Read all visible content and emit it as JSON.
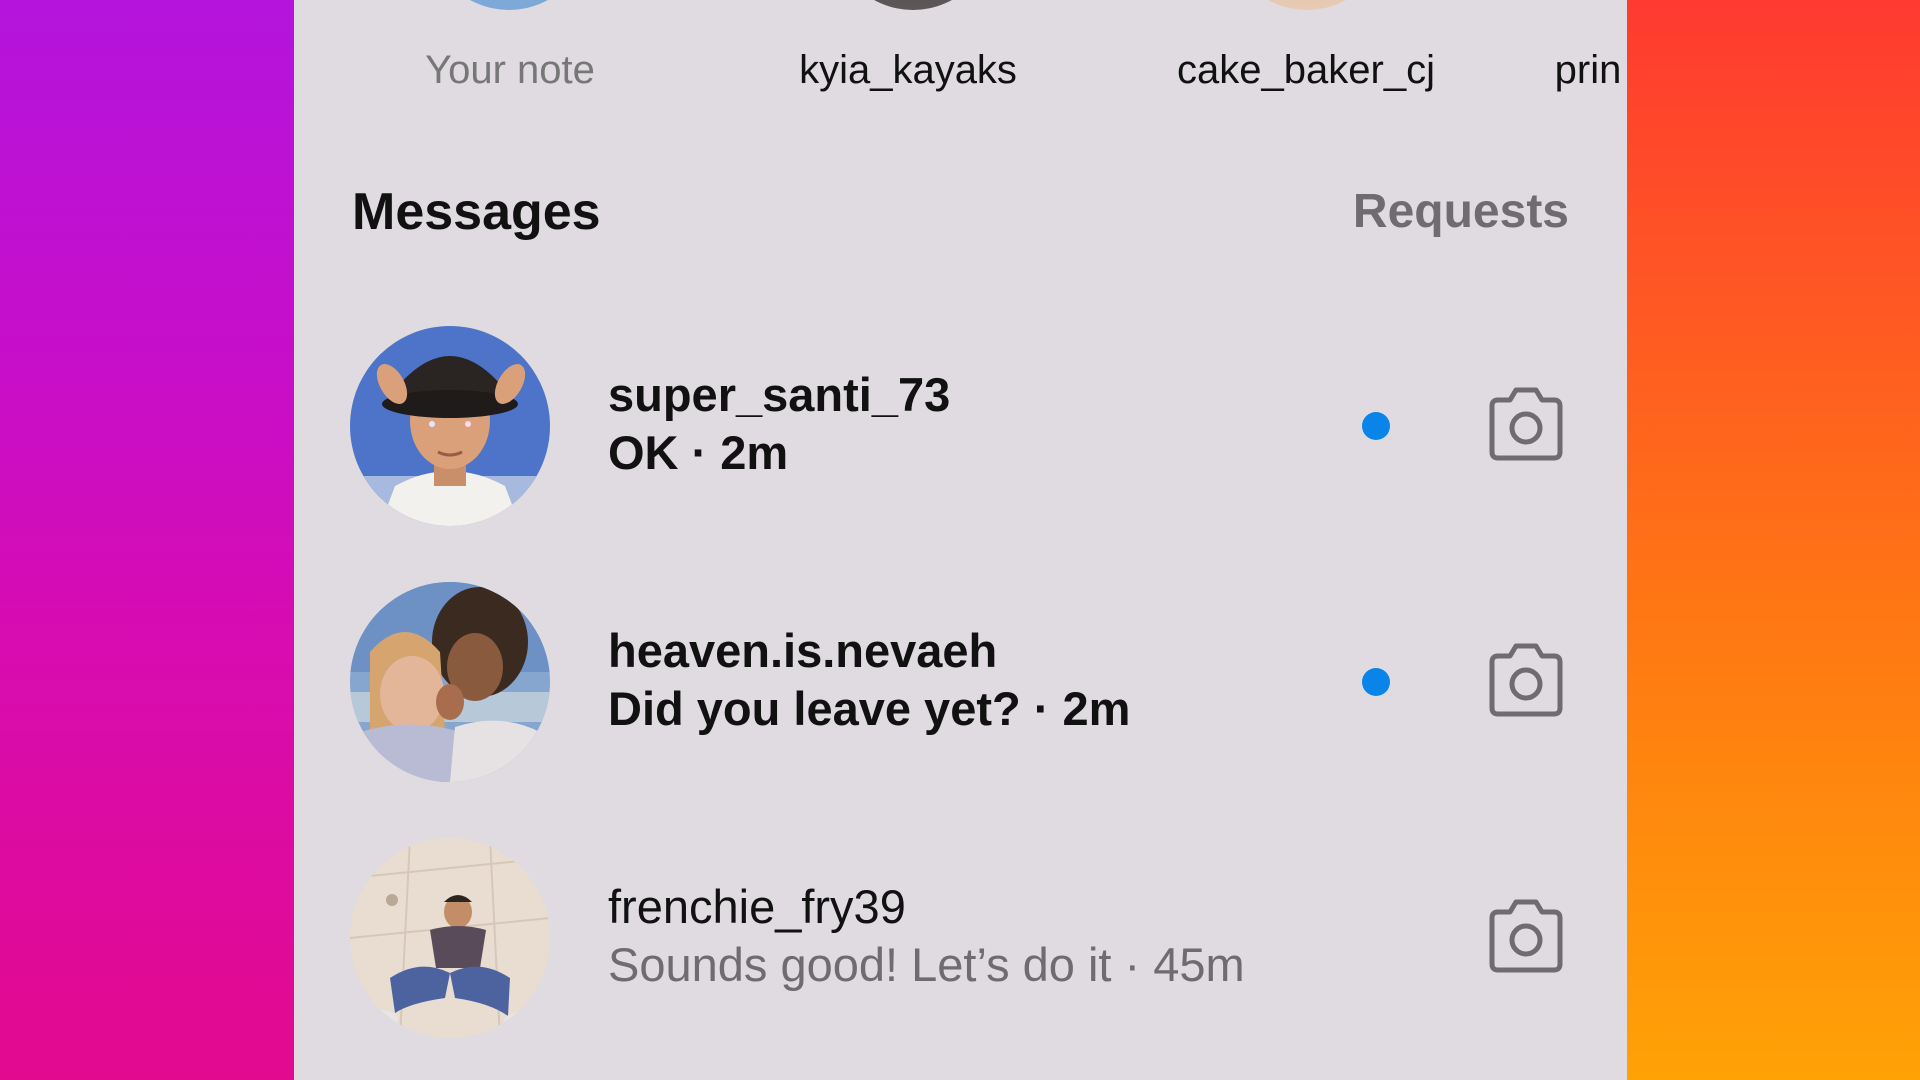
{
  "notes": [
    {
      "label": "Your note",
      "muted": true
    },
    {
      "label": "kyia_kayaks",
      "muted": false
    },
    {
      "label": "cake_baker_cj",
      "muted": false
    },
    {
      "label": "prin",
      "muted": false
    }
  ],
  "header": {
    "title": "Messages",
    "requests_label": "Requests"
  },
  "threads": [
    {
      "username": "super_santi_73",
      "preview": "OK · 2m",
      "unread": true
    },
    {
      "username": "heaven.is.nevaeh",
      "preview": "Did you leave yet? · 2m",
      "unread": true
    },
    {
      "username": "frenchie_fry39",
      "preview": "Sounds good! Let’s do it · 45m",
      "unread": false
    }
  ],
  "colors": {
    "unread_dot": "#0a84e8",
    "panel_bg": "#dfdbe0",
    "muted_text": "#6f6c70"
  },
  "icons": [
    "camera-icon",
    "avatar-photo"
  ]
}
